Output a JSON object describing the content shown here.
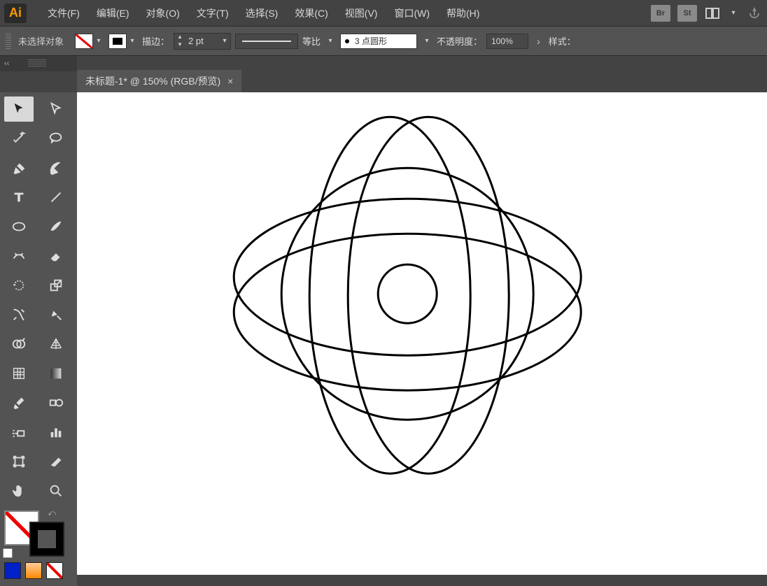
{
  "app": {
    "logo": "Ai"
  },
  "menu": {
    "file": "文件(F)",
    "edit": "编辑(E)",
    "object": "对象(O)",
    "type": "文字(T)",
    "select": "选择(S)",
    "effect": "效果(C)",
    "view": "视图(V)",
    "window": "窗口(W)",
    "help": "帮助(H)"
  },
  "menubar_right": {
    "br": "Br",
    "st": "St"
  },
  "control": {
    "status": "未选择对象",
    "stroke_label": "描边：",
    "stroke_weight": "2 pt",
    "profile_label": "等比",
    "brush_label": "3 点圆形",
    "opacity_label": "不透明度：",
    "opacity_value": "100%",
    "style_label": "样式："
  },
  "panel": {
    "collapse": "‹‹"
  },
  "tab": {
    "title": "未标题-1* @ 150% (RGB/预览)",
    "close": "×"
  },
  "tools": [
    {
      "id": "selection",
      "active": true
    },
    {
      "id": "direct-selection"
    },
    {
      "id": "magic-wand"
    },
    {
      "id": "lasso"
    },
    {
      "id": "pen"
    },
    {
      "id": "curvature"
    },
    {
      "id": "type"
    },
    {
      "id": "line"
    },
    {
      "id": "ellipse"
    },
    {
      "id": "paintbrush"
    },
    {
      "id": "shaper"
    },
    {
      "id": "eraser"
    },
    {
      "id": "rotate"
    },
    {
      "id": "scale"
    },
    {
      "id": "width"
    },
    {
      "id": "free-transform"
    },
    {
      "id": "shape-builder"
    },
    {
      "id": "perspective"
    },
    {
      "id": "mesh"
    },
    {
      "id": "gradient"
    },
    {
      "id": "eyedropper"
    },
    {
      "id": "blend"
    },
    {
      "id": "symbol-sprayer"
    },
    {
      "id": "column-graph"
    },
    {
      "id": "artboard"
    },
    {
      "id": "slice"
    },
    {
      "id": "hand"
    },
    {
      "id": "zoom"
    }
  ]
}
